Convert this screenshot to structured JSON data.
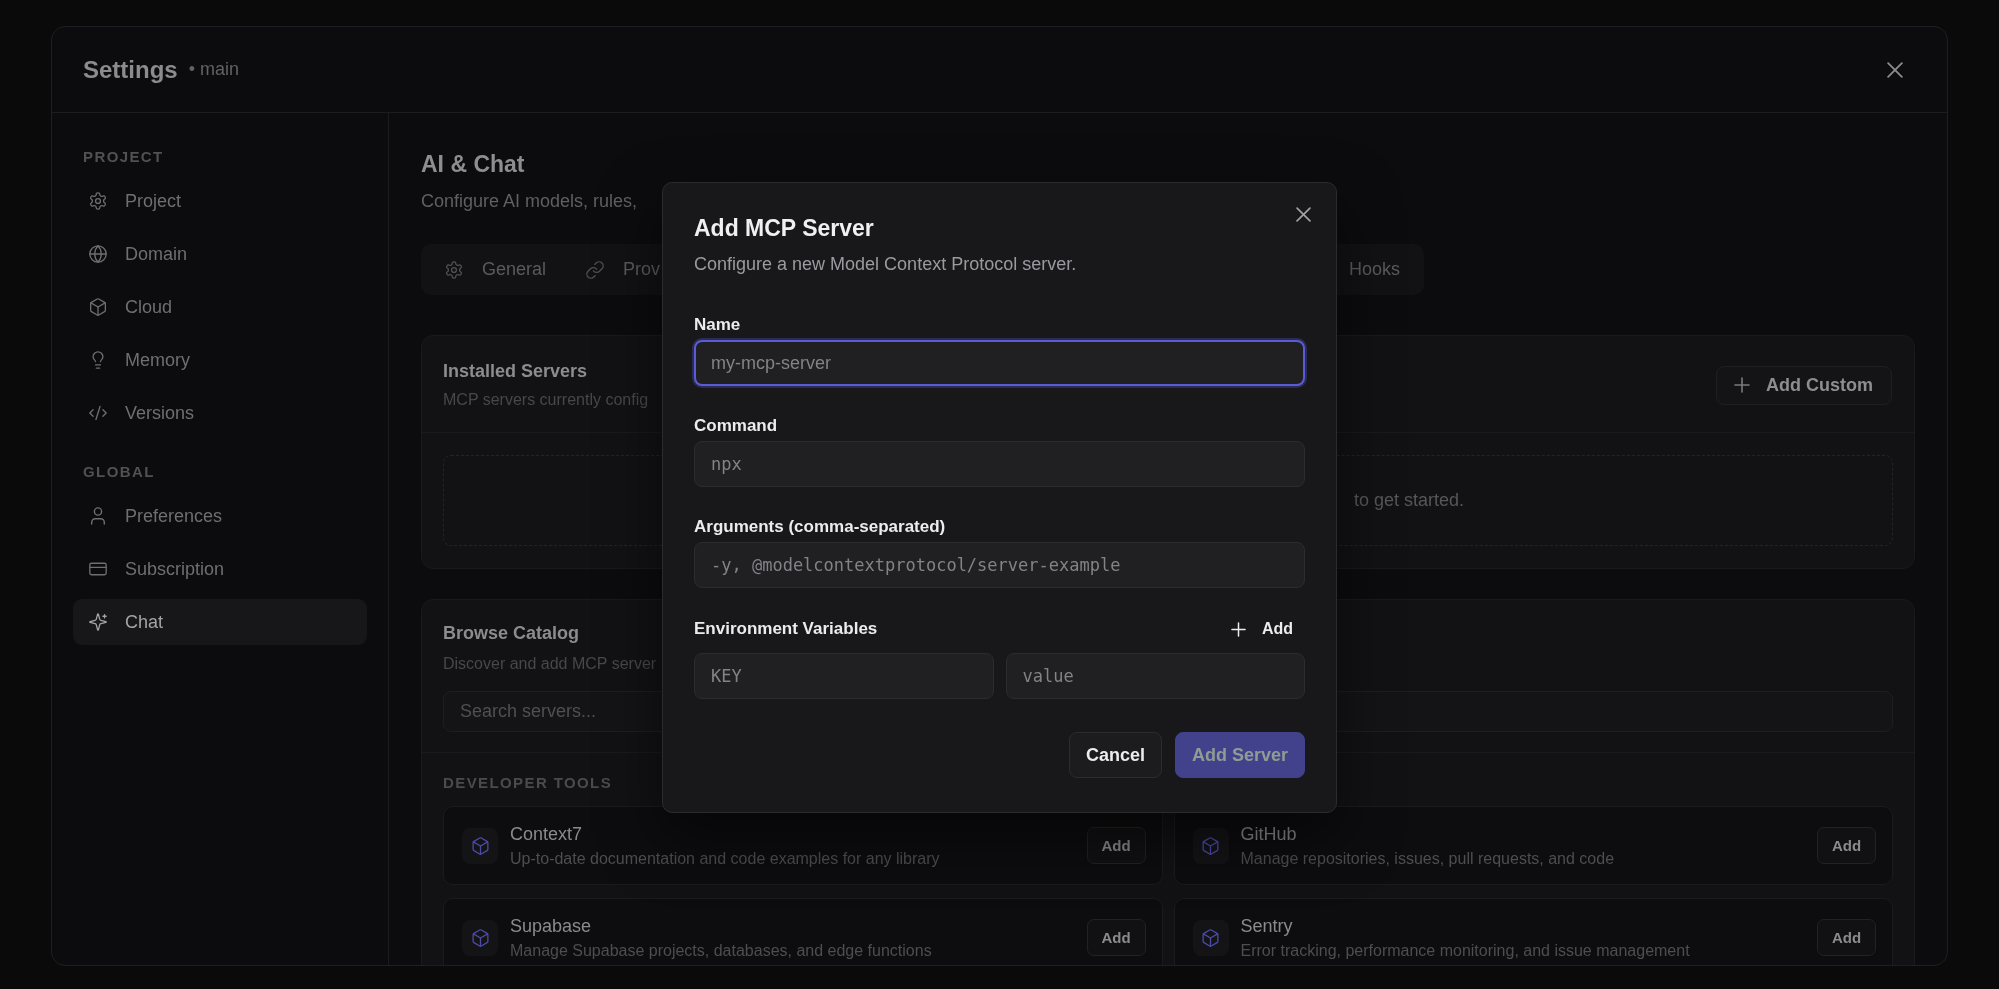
{
  "window": {
    "title": "Settings",
    "branch": "• main"
  },
  "sidebar": {
    "sections": [
      {
        "heading": "PROJECT",
        "items": [
          {
            "label": "Project",
            "selected": false
          },
          {
            "label": "Domain",
            "selected": false
          },
          {
            "label": "Cloud",
            "selected": false
          },
          {
            "label": "Memory",
            "selected": false
          },
          {
            "label": "Versions",
            "selected": false
          }
        ]
      },
      {
        "heading": "GLOBAL",
        "items": [
          {
            "label": "Preferences",
            "selected": false
          },
          {
            "label": "Subscription",
            "selected": false
          },
          {
            "label": "Chat",
            "selected": true
          }
        ]
      }
    ]
  },
  "page": {
    "title": "AI & Chat",
    "subtitle": "Configure AI models, rules,"
  },
  "tabs": [
    {
      "label": "General",
      "selected": false
    },
    {
      "label": "Prov",
      "selected": false
    },
    {
      "label": "Hooks",
      "selected": false
    }
  ],
  "installed": {
    "title": "Installed Servers",
    "subtitle": "MCP servers currently config",
    "add_button": "Add Custom",
    "empty_text": "to get started."
  },
  "catalog": {
    "title": "Browse Catalog",
    "subtitle": "Discover and add MCP server",
    "search": {
      "placeholder": "Search servers..."
    },
    "category": "DEVELOPER TOOLS",
    "servers": [
      {
        "name": "Context7",
        "description": "Up-to-date documentation and code examples for any library",
        "button": "Add"
      },
      {
        "name": "GitHub",
        "description": "Manage repositories, issues, pull requests, and code",
        "button": "Add"
      },
      {
        "name": "Supabase",
        "description": "Manage Supabase projects, databases, and edge functions",
        "button": "Add"
      },
      {
        "name": "Sentry",
        "description": "Error tracking, performance monitoring, and issue management",
        "button": "Add"
      }
    ]
  },
  "dialog": {
    "title": "Add MCP Server",
    "subtitle": "Configure a new Model Context Protocol server.",
    "fields": [
      {
        "label": "Name",
        "placeholder": "my-mcp-server",
        "kind": "text",
        "focused": true
      },
      {
        "label": "Command",
        "placeholder": "npx",
        "kind": "code",
        "focused": false
      },
      {
        "label": "Arguments (comma-separated)",
        "placeholder": "-y, @modelcontextprotocol/server-example",
        "kind": "code",
        "focused": false
      }
    ],
    "env": {
      "label": "Environment Variables",
      "add_button": "Add",
      "key_placeholder": "KEY",
      "value_placeholder": "value"
    },
    "buttons": [
      {
        "label": "Cancel",
        "kind": "secondary",
        "disabled": false
      },
      {
        "label": "Add Server",
        "kind": "primary",
        "disabled": true
      }
    ]
  }
}
